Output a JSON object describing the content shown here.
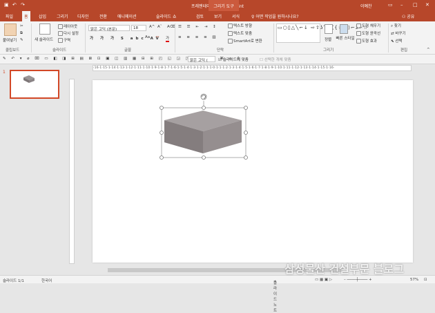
{
  "titlebar": {
    "title": "프레젠테이션1 - PowerPoint",
    "context_tab": "그리기 도구",
    "user": "이예찬",
    "colors": {
      "accent": "#b7472a",
      "selection": "#d24726"
    }
  },
  "tabs": [
    {
      "label": "파일"
    },
    {
      "label": "홈"
    },
    {
      "label": "삽입"
    },
    {
      "label": "그리기"
    },
    {
      "label": "디자인"
    },
    {
      "label": "전환"
    },
    {
      "label": "애니메이션"
    },
    {
      "label": "슬라이드 쇼"
    },
    {
      "label": "검토"
    },
    {
      "label": "보기"
    },
    {
      "label": "서식"
    }
  ],
  "tell_me": "어떤 작업을 원하시나요?",
  "share_label": "공유",
  "ribbon": {
    "clipboard": {
      "paste": "붙여넣기",
      "label": "클립보드"
    },
    "slides": {
      "new_slide": "새 슬라이드",
      "layout": "레이아웃",
      "reset": "다시 설정",
      "section": "구역",
      "label": "슬라이드"
    },
    "font": {
      "name": "맑은 고딕 (본문)",
      "size": "18",
      "label": "글꼴"
    },
    "paragraph": {
      "text_direction": "텍스트 방향",
      "align_text": "텍스트 맞춤",
      "smartart": "SmartArt로 변환",
      "label": "단락"
    },
    "drawing": {
      "arrange": "정렬",
      "quick_styles": "빠른 스타일",
      "fill": "도형 채우기",
      "outline": "도형 윤곽선",
      "effects": "도형 효과",
      "label": "그리기"
    },
    "editing": {
      "find": "찾기",
      "replace": "바꾸기",
      "select": "선택",
      "label": "편집"
    }
  },
  "qat": {
    "font": "맑은 고딕 (",
    "fit": "슬라이드에 맞춤",
    "select_objects": "선택한 개체 맞춤"
  },
  "ruler_text": "·16·1·15·1·14·1·13·1·12·1·11·1·10·1·9·1·8·1·7·1·6·1·5·1·4·1·3·1·2·1·1·1·0·1·1·1·2·1·3·1·4·1·5·1·6·1·7·1·8·1·9·1·10·1·11·1·12·1·13·1·14·1·15·1·16·",
  "slides": [
    {
      "number": "1"
    }
  ],
  "status": {
    "slide": "슬라이드 1/1",
    "language": "한국어",
    "notes": "슬라이드 노트",
    "zoom": "57%"
  },
  "watermark": "삼성물산 건설부문 블로그"
}
